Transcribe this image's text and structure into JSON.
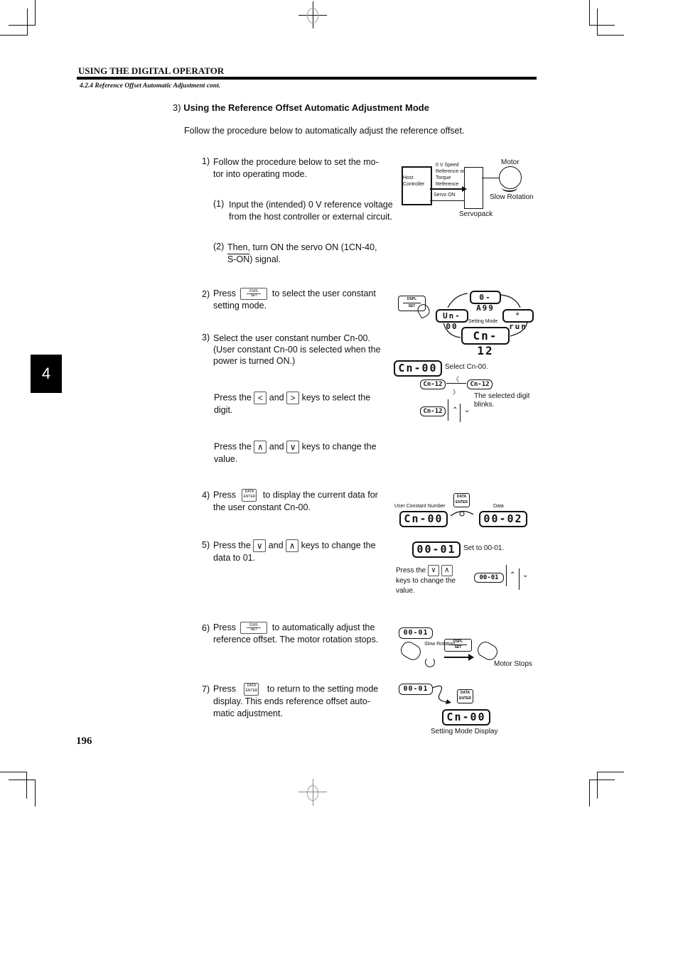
{
  "header": {
    "running_head": "USING THE DIGITAL OPERATOR",
    "subsection": "4.2.4 Reference Offset Automatic Adjustment cont."
  },
  "section": {
    "number": "3)",
    "title": "Using the Reference Offset Automatic Adjustment Mode",
    "intro": "Follow the procedure below to automatically adjust the reference offset."
  },
  "steps": [
    {
      "num": "1)",
      "text_line1": "Follow the procedure below to set the mo-",
      "text_line2": "tor into operating mode."
    },
    {
      "num": "2)",
      "pre": "Press",
      "post": "to select the user constant",
      "line2": "setting mode."
    },
    {
      "num": "3)",
      "line1": "Select the user constant number Cn-00.",
      "line2": "(User constant Cn-00 is selected when the",
      "line3": "power is turned ON.)"
    },
    {
      "num": "4)",
      "pre": "Press",
      "post": "to display the current data for",
      "line2": "the user constant Cn-00."
    },
    {
      "num": "5)",
      "pre": "Press the",
      "mid": "and",
      "post": "keys to change the",
      "line2": "data to 01."
    },
    {
      "num": "6)",
      "pre": "Press",
      "post": "to automatically adjust the",
      "line2": "reference offset. The motor rotation stops."
    },
    {
      "num": "7)",
      "pre": "Press",
      "post": "to return to the setting mode",
      "line2": "display. This ends reference offset auto-",
      "line3": "matic adjustment."
    }
  ],
  "substeps": {
    "s1": {
      "num": "(1)",
      "line1": "Input the (intended) 0 V reference voltage",
      "line2": "from the host controller or external circuit."
    },
    "s2": {
      "num": "(2)",
      "line1": "Then, turn ON the servo ON (1CN-40,",
      "overline": "S-ON",
      "line2_rest": ") signal."
    },
    "digit_select": {
      "pre": "Press the",
      "mid": "and",
      "post": "keys to select the",
      "line2": "digit."
    },
    "value_change": {
      "pre": "Press the",
      "mid": "and",
      "post": "keys to change the",
      "line2": "value."
    }
  },
  "keys": {
    "dspl": "DSPL",
    "set": "SET",
    "data": "DATA",
    "enter": "ENTER",
    "left": "<",
    "right": ">",
    "up": "∧",
    "down": "∨"
  },
  "diagram1": {
    "host": "Host Controller",
    "signal1": "0 V Speed Reference or Torque Reference",
    "signal2": "Servo ON",
    "servopack": "Servopack",
    "motor": "Motor",
    "rotation": "Slow Rotation"
  },
  "diagram2": {
    "top": "0-A99",
    "right": "° run",
    "bottom": "Cn- 12",
    "left": "Un-00",
    "center": "Setting Mode"
  },
  "diagram3": {
    "display": "Cn-00",
    "caption": "Select Cn-00.",
    "blink_a": "Cn-12",
    "blink_b": "Cn-12",
    "blink_caption": "The selected digit blinks.",
    "updown": "Cn-12"
  },
  "diagram4": {
    "label_left": "User Constant Number",
    "label_right": "Data",
    "display_left": "Cn-00",
    "display_right": "00-02"
  },
  "diagram5": {
    "display": "00-01",
    "caption": "Set to 00-01.",
    "press_pre": "Press the",
    "press_post": "keys to change the",
    "press_line2": "value.",
    "small": "00-01"
  },
  "diagram6": {
    "display": "00-01",
    "slow": "Slow Rotation",
    "stops": "Motor Stops"
  },
  "diagram7": {
    "display_top": "00-01",
    "display_bottom": "Cn-00",
    "caption": "Setting Mode Display"
  },
  "chapter_tab": "4",
  "page_number": "196"
}
